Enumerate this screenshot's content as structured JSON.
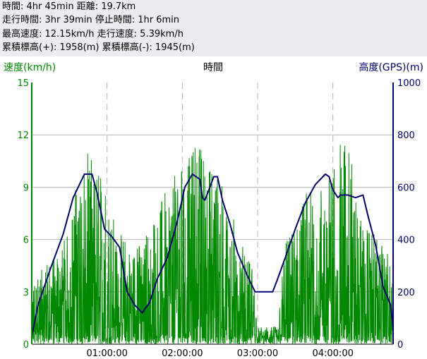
{
  "stats": {
    "lines": [
      "時間: 4hr 45min 距離: 19.7km",
      "走行時間: 3hr 39min 停止時間: 1hr 6min",
      "最高速度: 12.15km/h 走行速度: 5.39km/h",
      "累積標高(+): 1958(m) 累積標高(-): 1945(m)"
    ]
  },
  "colors": {
    "stats_bg": "#ebebf2",
    "speed": "#008800",
    "elevation": "#00006e",
    "grid": "#b4b4b4"
  },
  "chart_data": {
    "type": "line",
    "title": "",
    "xlabel": "時間",
    "x_unit": "minutes",
    "xlim": [
      0,
      288
    ],
    "x_ticks": [
      {
        "value": 60,
        "label": "01:00:00"
      },
      {
        "value": 120,
        "label": "02:00:00"
      },
      {
        "value": 180,
        "label": "03:00:00"
      },
      {
        "value": 240,
        "label": "04:00:00"
      }
    ],
    "grid": {
      "vertical": "dashed",
      "horizontal": "solid"
    },
    "left_axis": {
      "label": "速度(km/h)",
      "min": 0,
      "max": 15,
      "ticks": [
        "0",
        "3",
        "6",
        "9",
        "12",
        "15"
      ]
    },
    "right_axis": {
      "label": "高度(GPS)(m)",
      "min": 0,
      "max": 1000,
      "ticks": [
        "0",
        "200",
        "400",
        "600",
        "800",
        "1000"
      ]
    },
    "series": [
      {
        "name": "速度(km/h)",
        "axis": "left",
        "style": "noisy",
        "envelope": {
          "x": [
            0,
            10,
            20,
            30,
            38,
            44,
            50,
            58,
            64,
            72,
            80,
            88,
            96,
            104,
            112,
            118,
            124,
            130,
            136,
            144,
            152,
            160,
            168,
            176,
            180,
            188,
            196,
            200,
            206,
            212,
            216,
            222,
            228,
            236,
            244,
            252,
            256,
            262,
            270,
            278,
            285,
            288
          ],
          "y": [
            3.5,
            4.5,
            5.5,
            6.5,
            11,
            11,
            10.5,
            9.5,
            7.5,
            6.5,
            5.5,
            6,
            7.5,
            8.5,
            9.5,
            10.5,
            10.5,
            11.8,
            11.5,
            10.5,
            9,
            7.5,
            6,
            4.5,
            1,
            1,
            1,
            5.5,
            6.5,
            7,
            8.5,
            9,
            9.5,
            9.5,
            11.5,
            12,
            10.5,
            7.5,
            6.5,
            6,
            5,
            4
          ]
        }
      },
      {
        "name": "高度(GPS)(m)",
        "axis": "right",
        "x": [
          0,
          5,
          15,
          25,
          33,
          42,
          48,
          52,
          58,
          64,
          70,
          76,
          82,
          88,
          94,
          100,
          108,
          116,
          122,
          128,
          134,
          136,
          138,
          142,
          145,
          148,
          152,
          158,
          164,
          172,
          178,
          184,
          188,
          192,
          196,
          202,
          210,
          218,
          226,
          234,
          237,
          240,
          244,
          246,
          252,
          258,
          264,
          268,
          274,
          280,
          286,
          288
        ],
        "y": [
          30,
          150,
          290,
          420,
          560,
          650,
          650,
          580,
          440,
          410,
          370,
          200,
          150,
          120,
          160,
          250,
          330,
          470,
          600,
          650,
          630,
          560,
          550,
          600,
          640,
          640,
          550,
          460,
          350,
          260,
          200,
          200,
          200,
          200,
          250,
          330,
          440,
          540,
          610,
          650,
          640,
          590,
          560,
          570,
          570,
          560,
          570,
          490,
          380,
          220,
          150,
          60
        ]
      }
    ]
  }
}
